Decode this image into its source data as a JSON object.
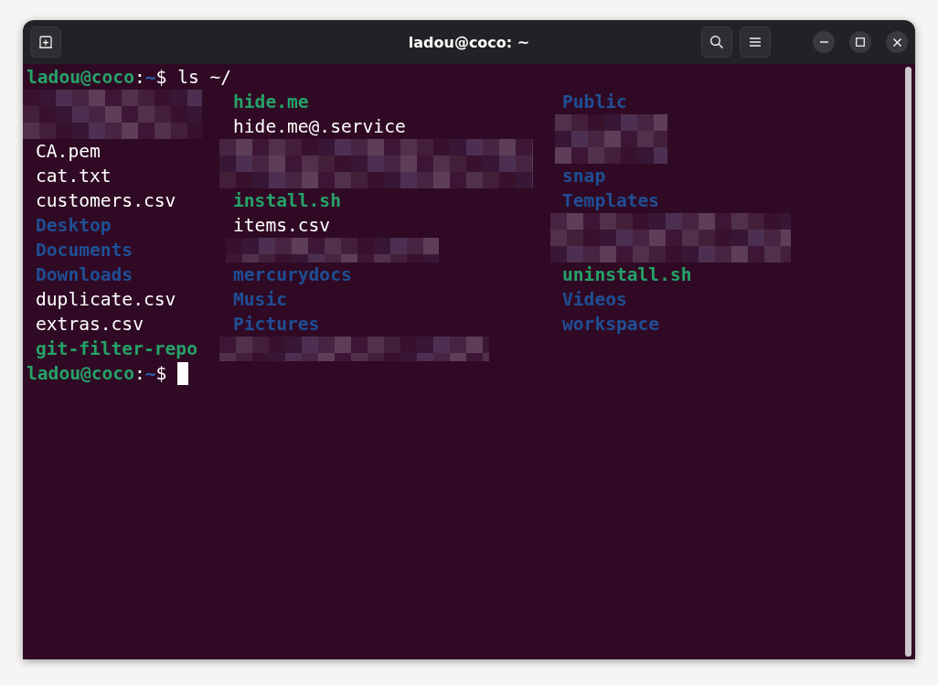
{
  "window": {
    "title": "ladou@coco: ~"
  },
  "terminal": {
    "lines": [
      {
        "kind": "prompt",
        "user_host": "ladou@coco",
        "separator": ":",
        "path": "~",
        "symbol": "$",
        "command": " ls ~/"
      },
      {
        "kind": "listing",
        "columns": [
          [
            {
              "kind": "redacted"
            },
            {
              "kind": "redacted"
            },
            {
              "kind": "file",
              "name": "CA.pem"
            },
            {
              "kind": "file",
              "name": "cat.txt"
            },
            {
              "kind": "file",
              "name": "customers.csv"
            },
            {
              "kind": "directory",
              "name": "Desktop"
            },
            {
              "kind": "directory",
              "name": "Documents"
            },
            {
              "kind": "directory",
              "name": "Downloads"
            },
            {
              "kind": "file",
              "name": "duplicate.csv"
            },
            {
              "kind": "file",
              "name": "extras.csv"
            },
            {
              "kind": "executable",
              "name": "git-filter-repo"
            }
          ],
          [
            {
              "kind": "executable",
              "name": "hide.me"
            },
            {
              "kind": "file",
              "name": "hide.me@.service"
            },
            {
              "kind": "redacted"
            },
            {
              "kind": "redacted"
            },
            {
              "kind": "executable",
              "name": "install.sh"
            },
            {
              "kind": "file",
              "name": "items.csv"
            },
            {
              "kind": "redacted"
            },
            {
              "kind": "directory",
              "name": "mercurydocs"
            },
            {
              "kind": "directory",
              "name": "Music"
            },
            {
              "kind": "directory",
              "name": "Pictures"
            },
            {
              "kind": "redacted"
            }
          ],
          [
            {
              "kind": "directory",
              "name": "Public"
            },
            {
              "kind": "redacted"
            },
            {
              "kind": "redacted"
            },
            {
              "kind": "directory",
              "name": "snap"
            },
            {
              "kind": "directory",
              "name": "Templates"
            },
            {
              "kind": "redacted"
            },
            {
              "kind": "redacted"
            },
            {
              "kind": "executable",
              "name": "uninstall.sh"
            },
            {
              "kind": "directory",
              "name": "Videos"
            },
            {
              "kind": "directory",
              "name": "workspace"
            }
          ]
        ]
      },
      {
        "kind": "prompt",
        "user_host": "ladou@coco",
        "separator": ":",
        "path": "~",
        "symbol": "$",
        "cursor": true
      }
    ]
  }
}
